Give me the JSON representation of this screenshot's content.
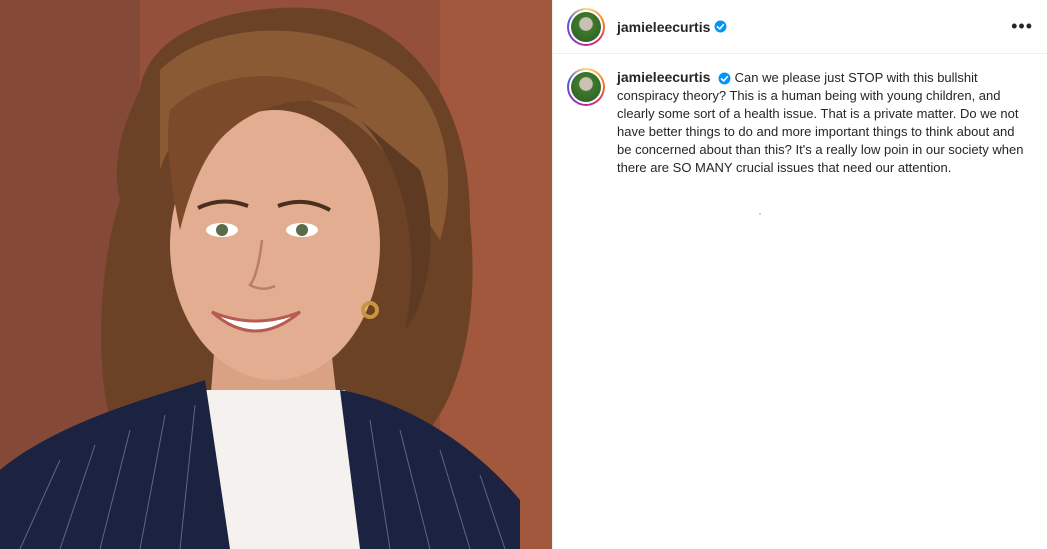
{
  "post": {
    "username": "jamieleecurtis",
    "verified": true,
    "more_icon": "more-horizontal-icon",
    "caption": "Can we please just STOP with this bullshit conspiracy theory? This is a human being with young children, and clearly some sort of a health issue. That is a private matter. Do we not have better things to do and more important things to think about and be concerned about than this? It's a really low poin in our society when there are SO MANY crucial issues that need our attention."
  },
  "colors": {
    "verified_blue": "#0095f6",
    "text": "#262626",
    "border": "#efefef"
  }
}
